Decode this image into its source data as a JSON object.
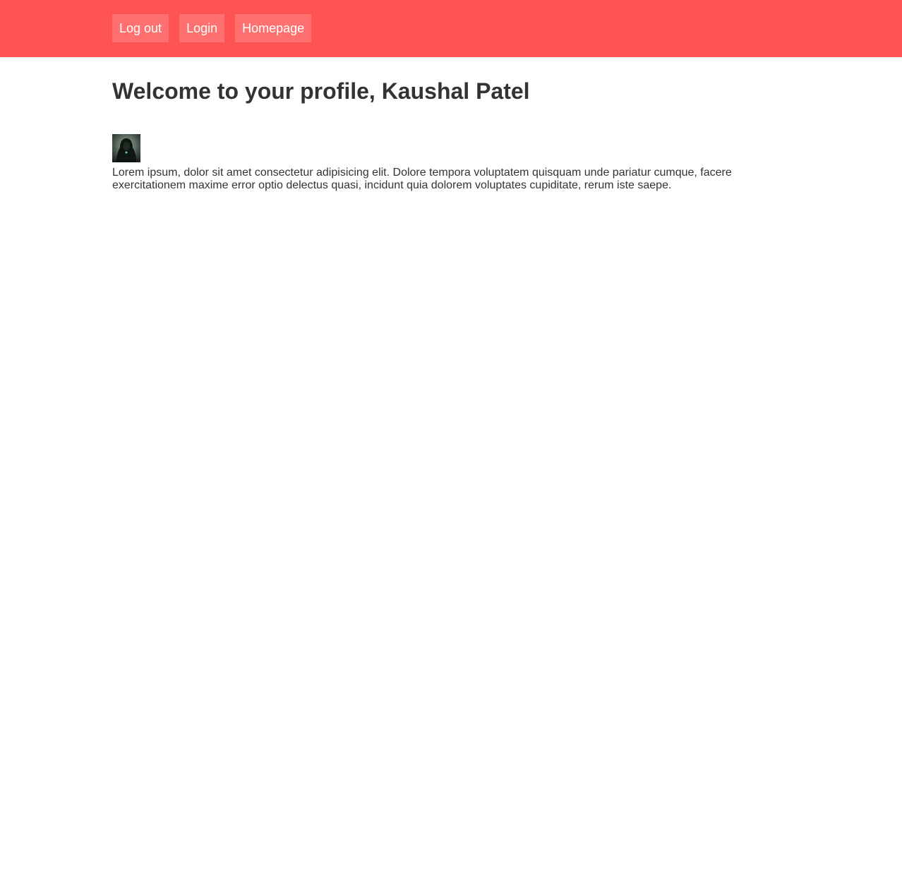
{
  "colors": {
    "header_bg": "#ff5252",
    "nav_button_bg": "#ff7070",
    "nav_text": "#ffffff",
    "body_text": "#333333"
  },
  "nav": {
    "items": [
      {
        "label": "Log out"
      },
      {
        "label": "Login"
      },
      {
        "label": "Homepage"
      }
    ]
  },
  "profile": {
    "title": "Welcome to your profile, Kaushal Patel",
    "avatar_icon": "user-avatar-image",
    "bio": "Lorem ipsum, dolor sit amet consectetur adipisicing elit. Dolore tempora voluptatem quisquam unde pariatur cumque, facere exercitationem maxime error optio delectus quasi, incidunt quia dolorem voluptates cupiditate, rerum iste saepe."
  }
}
